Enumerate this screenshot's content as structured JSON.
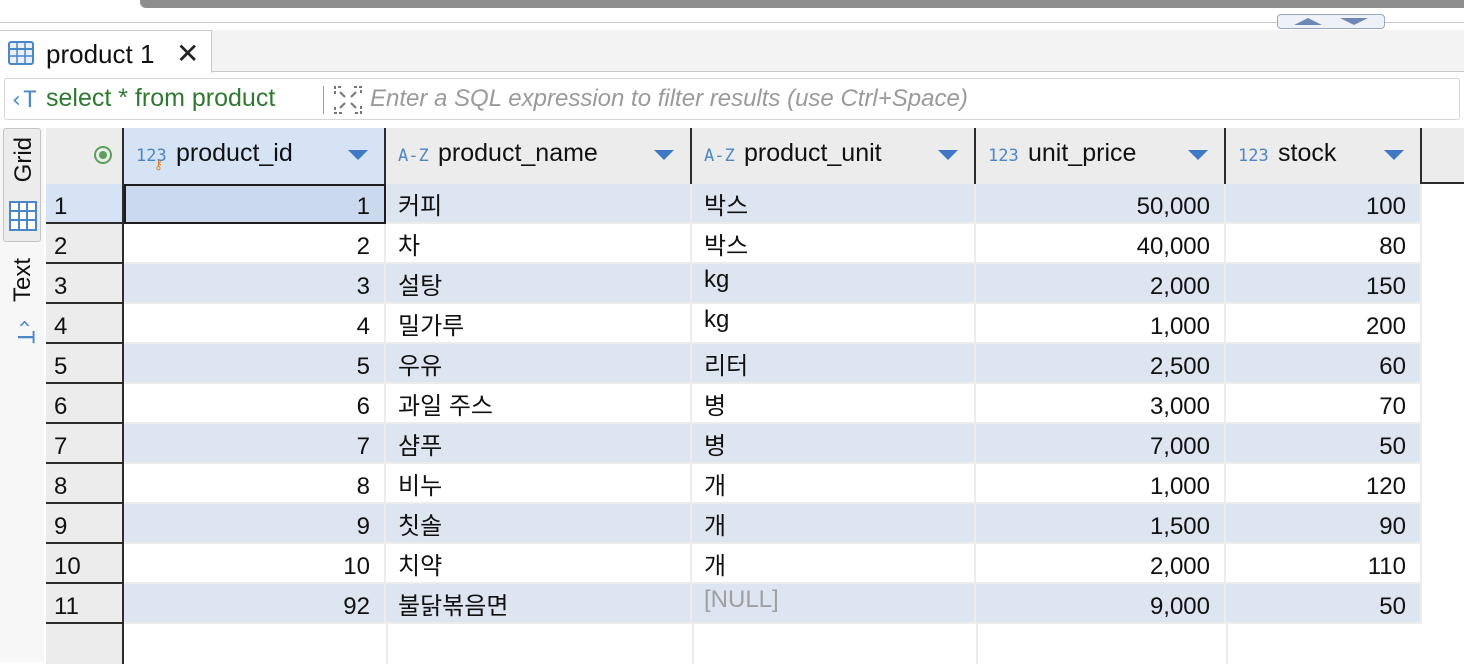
{
  "tab": {
    "label": "product 1",
    "close": "✕"
  },
  "filter": {
    "query": "select * from product",
    "placeholder": "Enter a SQL expression to filter results (use Ctrl+Space)"
  },
  "side_tabs": {
    "grid": "Grid",
    "text": "Text"
  },
  "icons": {
    "tab": "table-grid-icon",
    "query": "sql-text-icon",
    "expand": "expand-icon",
    "sort": "sort-dropdown-icon",
    "row_header": "record-mode-icon"
  },
  "columns": [
    {
      "type": "123",
      "name": "product_id",
      "align": "right"
    },
    {
      "type": "A-Z",
      "name": "product_name",
      "align": "left"
    },
    {
      "type": "A-Z",
      "name": "product_unit",
      "align": "left"
    },
    {
      "type": "123",
      "name": "unit_price",
      "align": "right"
    },
    {
      "type": "123",
      "name": "stock",
      "align": "right"
    }
  ],
  "rows": [
    {
      "n": "1",
      "cells": [
        "1",
        "커피",
        "박스",
        "50,000",
        "100"
      ]
    },
    {
      "n": "2",
      "cells": [
        "2",
        "차",
        "박스",
        "40,000",
        "80"
      ]
    },
    {
      "n": "3",
      "cells": [
        "3",
        "설탕",
        "kg",
        "2,000",
        "150"
      ]
    },
    {
      "n": "4",
      "cells": [
        "4",
        "밀가루",
        "kg",
        "1,000",
        "200"
      ]
    },
    {
      "n": "5",
      "cells": [
        "5",
        "우유",
        "리터",
        "2,500",
        "60"
      ]
    },
    {
      "n": "6",
      "cells": [
        "6",
        "과일 주스",
        "병",
        "3,000",
        "70"
      ]
    },
    {
      "n": "7",
      "cells": [
        "7",
        "샴푸",
        "병",
        "7,000",
        "50"
      ]
    },
    {
      "n": "8",
      "cells": [
        "8",
        "비누",
        "개",
        "1,000",
        "120"
      ]
    },
    {
      "n": "9",
      "cells": [
        "9",
        "칫솔",
        "개",
        "1,500",
        "90"
      ]
    },
    {
      "n": "10",
      "cells": [
        "10",
        "치약",
        "개",
        "2,000",
        "110"
      ]
    },
    {
      "n": "11",
      "cells": [
        "92",
        "불닭볶음면",
        "[NULL]",
        "9,000",
        "50"
      ]
    }
  ],
  "colors": {
    "selected_header": "#d5e3f5",
    "odd_row": "#dde5f1",
    "query_text": "#2f7a2f",
    "type_icon": "#4a86c8"
  }
}
